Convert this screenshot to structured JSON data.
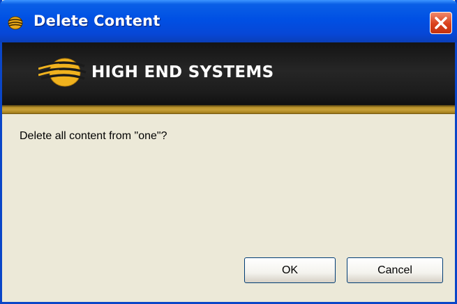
{
  "window": {
    "title": "Delete Content",
    "close_icon": "close-x-icon"
  },
  "banner": {
    "logo_text": "HIGH END SYSTEMS",
    "logo_icon": "globe-logo-icon"
  },
  "dialog": {
    "message": "Delete all content from \"one\"?",
    "ok_label": "OK",
    "cancel_label": "Cancel"
  },
  "colors": {
    "titlebar": "#0054e3",
    "close_button": "#d9401b",
    "banner": "#1e1e1e",
    "gold_stripe": "#c9a23a",
    "dialog_background": "#ece9d8"
  }
}
